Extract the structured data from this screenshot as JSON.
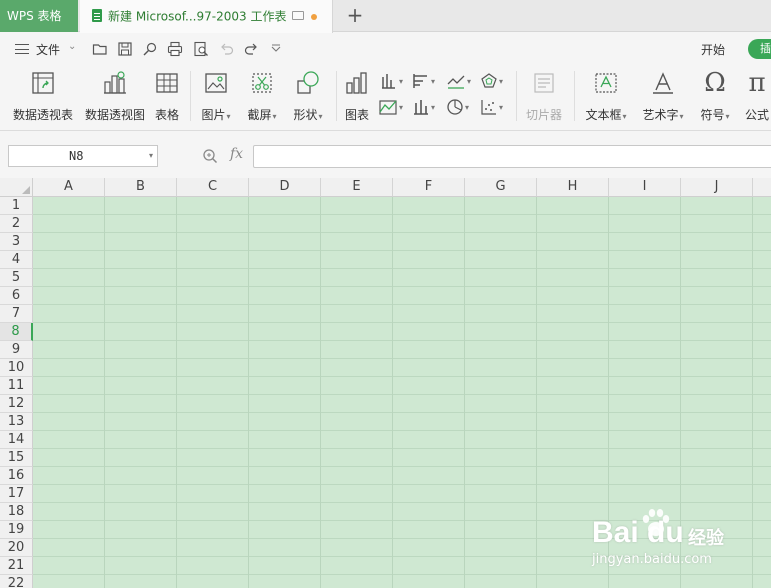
{
  "tabs": {
    "app": "WPS 表格",
    "document": "新建 Microsof...97-2003 工作表",
    "new_tab": "+"
  },
  "toolbar": {
    "file_menu": "文件",
    "menu_tabs": [
      "开始",
      "插"
    ]
  },
  "ribbon": {
    "buttons": [
      {
        "label": "数据透视表",
        "icon": "pivot-table-icon"
      },
      {
        "label": "数据透视图",
        "icon": "pivot-chart-icon"
      },
      {
        "label": "表格",
        "icon": "table-icon"
      },
      {
        "label": "图片",
        "icon": "picture-icon"
      },
      {
        "label": "截屏",
        "icon": "screenshot-icon"
      },
      {
        "label": "形状",
        "icon": "shapes-icon"
      },
      {
        "label": "图表",
        "icon": "chart-icon"
      },
      {
        "label": "切片器",
        "icon": "slicer-icon"
      },
      {
        "label": "文本框",
        "icon": "textbox-icon"
      },
      {
        "label": "艺术字",
        "icon": "wordart-icon"
      },
      {
        "label": "符号",
        "icon": "symbol-icon"
      },
      {
        "label": "公式",
        "icon": "formula-icon"
      }
    ]
  },
  "formula_bar": {
    "name_box": "N8",
    "fx": "fx",
    "formula": ""
  },
  "sheet": {
    "columns": [
      "A",
      "B",
      "C",
      "D",
      "E",
      "F",
      "G",
      "H",
      "I",
      "J"
    ],
    "rows": [
      "1",
      "2",
      "3",
      "4",
      "5",
      "6",
      "7",
      "8",
      "9",
      "10",
      "11",
      "12",
      "13",
      "14",
      "15",
      "16",
      "17",
      "18",
      "19",
      "20",
      "21",
      "22"
    ],
    "active_row": "8"
  },
  "watermark": {
    "brand": "Bai du",
    "sub": "经验",
    "url": "jingyan.baidu.com"
  },
  "colors": {
    "accent": "#3aa757",
    "app_tab": "#5aa96b",
    "cell_bg": "#cfe8d2"
  }
}
